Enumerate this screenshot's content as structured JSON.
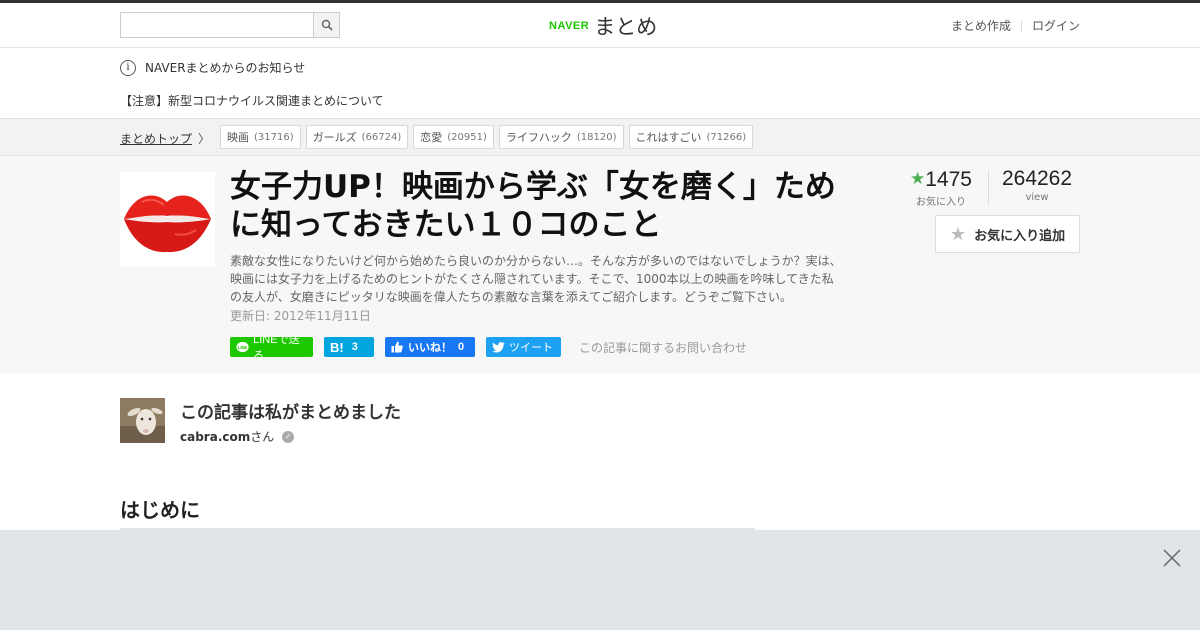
{
  "header": {
    "search_placeholder": "",
    "logo_naver": "NAVER",
    "logo_matome": "まとめ",
    "link_create": "まとめ作成",
    "link_login": "ログイン"
  },
  "notice": {
    "heading": "NAVERまとめからのお知らせ",
    "info_glyph": "i",
    "link": "【注意】新型コロナウイルス関連まとめについて"
  },
  "breadcrumb": {
    "top": "まとめトップ",
    "chevron": "〉",
    "tags": [
      {
        "label": "映画",
        "count": "(31716)"
      },
      {
        "label": "ガールズ",
        "count": "(66724)"
      },
      {
        "label": "恋愛",
        "count": "(20951)"
      },
      {
        "label": "ライフハック",
        "count": "(18120)"
      },
      {
        "label": "これはすごい",
        "count": "(71266)"
      }
    ]
  },
  "article": {
    "title": "女子力UP！映画から学ぶ「女を磨く」ために知っておきたい１０コのこと",
    "description": "素敵な女性になりたいけど何から始めたら良いのか分からない…。そんな方が多いのではないでしょうか？実は、映画には女子力を上げるためのヒントがたくさん隠されています。そこで、1000本以上の映画を吟味してきた私の友人が、女磨きにピッタリな映画を偉人たちの素敵な言葉を添えてご紹介します。どうぞご覧下さい。",
    "updated": "更新日: 2012年11月11日",
    "share": {
      "line": "LINEで送る",
      "hatena": "B!",
      "hatena_count": "3",
      "fb": "いいね！",
      "fb_count": "0",
      "tweet": "ツイート"
    },
    "inquiry": "この記事に関するお問い合わせ",
    "favorites": "1475",
    "favorites_label": "お気に入り",
    "views": "264262",
    "views_label": "view",
    "fav_button": "お気に入り追加"
  },
  "author": {
    "title": "この記事は私がまとめました",
    "name": "cabra.com",
    "suffix": "さん"
  },
  "section": {
    "heading": "はじめに"
  },
  "colors": {
    "naver_green": "#1ec800",
    "hatena_blue": "#00a4de",
    "facebook_blue": "#1877f2",
    "twitter_blue": "#1da1f2",
    "favorite_star": "#4caf50"
  },
  "icons": [
    "search-icon",
    "info-icon",
    "chevron-right-icon",
    "star-icon",
    "line-icon",
    "like-icon",
    "twitter-bird-icon",
    "verified-icon",
    "close-icon"
  ]
}
